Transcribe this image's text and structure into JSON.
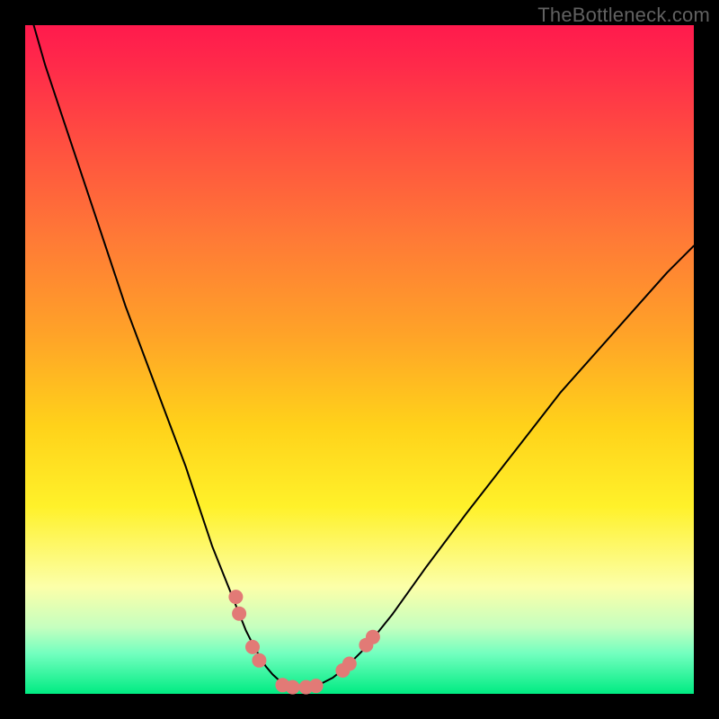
{
  "watermark": "TheBottleneck.com",
  "chart_data": {
    "type": "line",
    "title": "",
    "xlabel": "",
    "ylabel": "",
    "xlim": [
      0,
      100
    ],
    "ylim": [
      0,
      100
    ],
    "series": [
      {
        "name": "bottleneck-curve",
        "x": [
          1,
          3,
          6,
          9,
          12,
          15,
          18,
          21,
          24,
          26,
          28,
          30,
          32,
          33,
          34,
          35,
          36,
          37,
          38,
          39,
          40,
          42,
          44,
          46,
          48,
          51,
          55,
          60,
          66,
          73,
          80,
          88,
          96,
          100
        ],
        "y": [
          101,
          94,
          85,
          76,
          67,
          58,
          50,
          42,
          34,
          28,
          22,
          17,
          12,
          9.5,
          7.5,
          5.7,
          4.1,
          2.9,
          2.0,
          1.3,
          1.0,
          1.0,
          1.4,
          2.4,
          4.0,
          7.0,
          12,
          19,
          27,
          36,
          45,
          54,
          63,
          67
        ]
      }
    ],
    "markers": {
      "name": "marker-dots",
      "color": "#e27a76",
      "points": [
        {
          "x": 31.5,
          "y": 14.5
        },
        {
          "x": 32.0,
          "y": 12.0
        },
        {
          "x": 34.0,
          "y": 7.0
        },
        {
          "x": 35.0,
          "y": 5.0
        },
        {
          "x": 38.5,
          "y": 1.3
        },
        {
          "x": 40.0,
          "y": 1.0
        },
        {
          "x": 42.0,
          "y": 1.0
        },
        {
          "x": 43.5,
          "y": 1.2
        },
        {
          "x": 47.5,
          "y": 3.5
        },
        {
          "x": 48.5,
          "y": 4.5
        },
        {
          "x": 51.0,
          "y": 7.3
        },
        {
          "x": 52.0,
          "y": 8.5
        }
      ]
    },
    "gradient_stops": [
      {
        "pos": 0.0,
        "color": "#ff1a4d"
      },
      {
        "pos": 0.5,
        "color": "#ffd21a"
      },
      {
        "pos": 0.85,
        "color": "#fcffa9"
      },
      {
        "pos": 1.0,
        "color": "#00eb82"
      }
    ]
  }
}
